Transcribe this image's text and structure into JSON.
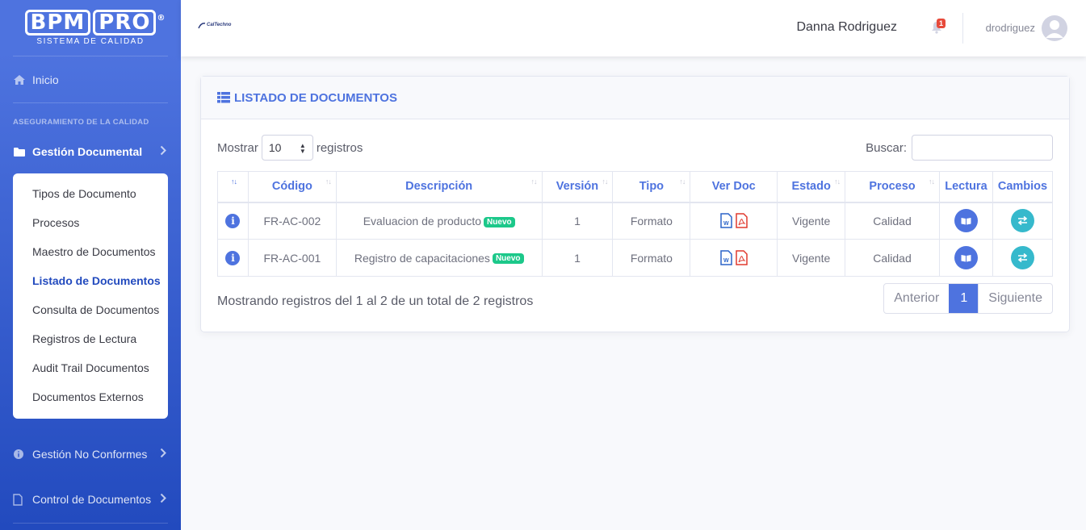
{
  "brand": {
    "name_part1": "BPM",
    "name_part2": "PRO",
    "reg": "®",
    "tagline": "SISTEMA DE CALIDAD"
  },
  "sidebar": {
    "home_label": "Inicio",
    "section_heading": "ASEGURAMIENTO DE LA CALIDAD",
    "items": [
      {
        "label": "Gestión Documental",
        "icon": "folder-icon"
      },
      {
        "label": "Gestión No Conformes",
        "icon": "info-circle-icon"
      },
      {
        "label": "Control de Documentos",
        "icon": "file-icon"
      }
    ],
    "submenu": [
      "Tipos de Documento",
      "Procesos",
      "Maestro de Documentos",
      "Listado de Documentos",
      "Consulta de Documentos",
      "Registros de Lectura",
      "Audit Trail Documentos",
      "Documentos Externos"
    ]
  },
  "topbar": {
    "logo_text": "CalTechno",
    "user_full_name": "Danna Rodriguez",
    "notification_count": "1",
    "username": "drodriguez"
  },
  "card": {
    "title": "LISTADO DE DOCUMENTOS",
    "show_label": "Mostrar",
    "page_size": "10",
    "records_label": "registros",
    "search_label": "Buscar:",
    "search_value": "",
    "columns": [
      "",
      "Código",
      "Descripción",
      "Versión",
      "Tipo",
      "Ver Doc",
      "Estado",
      "Proceso",
      "Lectura",
      "Cambios"
    ],
    "rows": [
      {
        "code": "FR-AC-002",
        "description": "Evaluacion de producto",
        "badge": "Nuevo",
        "version": "1",
        "type": "Formato",
        "status": "Vigente",
        "process": "Calidad"
      },
      {
        "code": "FR-AC-001",
        "description": "Registro de capacitaciones",
        "badge": "Nuevo",
        "version": "1",
        "type": "Formato",
        "status": "Vigente",
        "process": "Calidad"
      }
    ],
    "footer_info": "Mostrando registros del 1 al 2 de un total de 2 registros",
    "pagination": {
      "prev": "Anterior",
      "current": "1",
      "next": "Siguiente"
    }
  },
  "colors": {
    "primary": "#4e73df",
    "success": "#1cc88a",
    "info": "#36b9cc",
    "danger": "#e74a3b"
  }
}
